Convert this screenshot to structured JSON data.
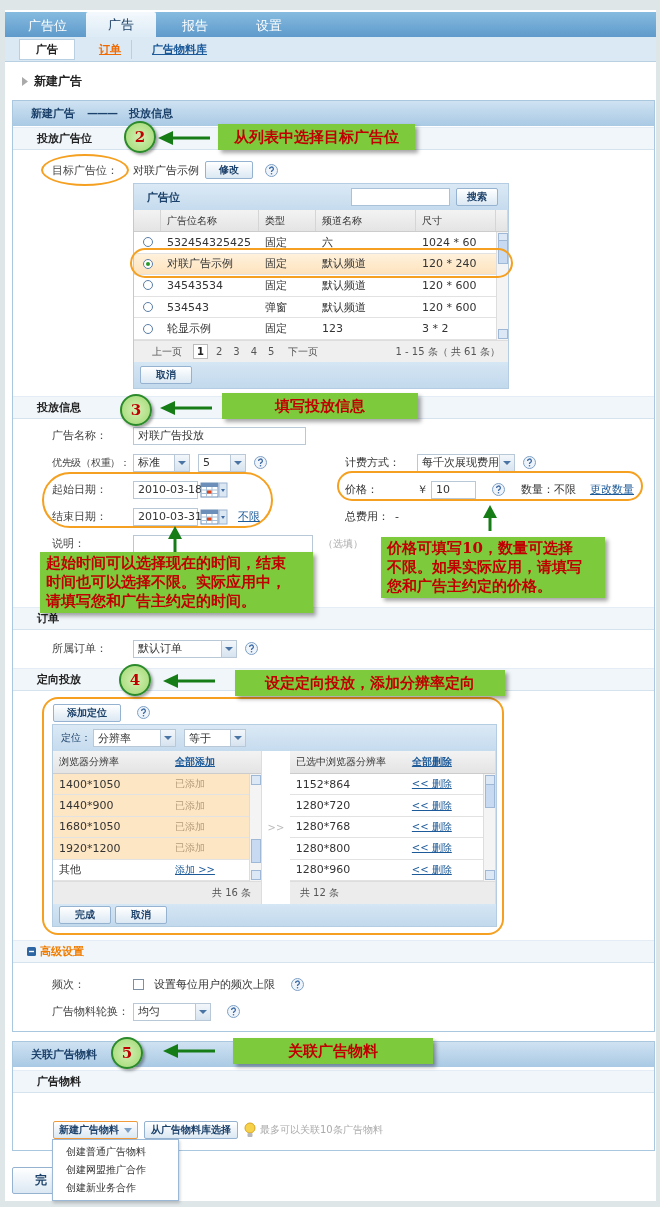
{
  "nav": {
    "tabs": [
      {
        "label": "广告位",
        "selected": false
      },
      {
        "label": "广告",
        "selected": true
      },
      {
        "label": "报告",
        "selected": false
      },
      {
        "label": "设置",
        "selected": false
      }
    ],
    "subtabs": [
      {
        "label": "广告",
        "selected": true,
        "kind": "plain"
      },
      {
        "label": "订单",
        "selected": false,
        "kind": "accent-link"
      },
      {
        "label": "广告物料库",
        "selected": false,
        "kind": "link"
      }
    ]
  },
  "title": "新建广告",
  "panel_header": {
    "step": "新建广告",
    "separator": "———",
    "current": "投放信息"
  },
  "placement": {
    "heading": "投放广告位",
    "label": "目标广告位：",
    "value": "对联广告示例",
    "edit_button": "修改",
    "table": {
      "title": "广告位",
      "search_button": "搜索",
      "columns": [
        "广告位名称",
        "类型",
        "频道名称",
        "尺寸"
      ],
      "rows": [
        {
          "selected": false,
          "cells": [
            "532454325425",
            "固定",
            "六",
            "1024 * 60"
          ]
        },
        {
          "selected": true,
          "cells": [
            "对联广告示例",
            "固定",
            "默认频道",
            "120 * 240"
          ]
        },
        {
          "selected": false,
          "cells": [
            "34543534",
            "固定",
            "默认频道",
            "120 * 600"
          ]
        },
        {
          "selected": false,
          "cells": [
            "534543",
            "弹窗",
            "默认频道",
            "120 * 600"
          ]
        },
        {
          "selected": false,
          "cells": [
            "轮显示例",
            "固定",
            "123",
            "3 * 2"
          ]
        }
      ],
      "pager": {
        "prev": "上一页",
        "pages": [
          {
            "label": "1",
            "selected": true
          },
          {
            "label": "2",
            "selected": false
          },
          {
            "label": "3",
            "selected": false
          },
          {
            "label": "4",
            "selected": false
          },
          {
            "label": "5",
            "selected": false
          }
        ],
        "next": "下一页",
        "summary": "1 - 15 条（ 共 61 条）"
      },
      "cancel_button": "取消"
    }
  },
  "delivery": {
    "heading": "投放信息",
    "name_label": "广告名称：",
    "name_value": "对联广告投放",
    "priority_label": "优先级（权重）：",
    "priority_value": "标准",
    "weight_value": "5",
    "start_label": "起始日期：",
    "start_value": "2010-03-18",
    "end_label": "结束日期：",
    "end_value": "2010-03-31",
    "unlimited_link": "不限",
    "note_label": "说明：",
    "note_hint": "（选填）",
    "billing_label": "计费方式：",
    "billing_value": "每千次展现费用",
    "price_label": "价格：",
    "currency": "￥",
    "price_value": "10",
    "quantity_label": "数量：",
    "quantity_value": "不限",
    "change_quantity_link": "更改数量",
    "total_label": "总费用：",
    "total_value": "-"
  },
  "order": {
    "heading": "订单",
    "label": "所属订单：",
    "value": "默认订单"
  },
  "targeting": {
    "heading": "定向投放",
    "add_button": "添加定位",
    "filter_label": "定位：",
    "dimension": "分辨率",
    "operator": "等于",
    "available": {
      "columns": [
        "浏览器分辨率",
        "全部添加"
      ],
      "rows": [
        {
          "value": "1400*1050",
          "action": "已添加",
          "added": true
        },
        {
          "value": "1440*900",
          "action": "已添加",
          "added": true
        },
        {
          "value": "1680*1050",
          "action": "已添加",
          "added": true
        },
        {
          "value": "1920*1200",
          "action": "已添加",
          "added": true
        },
        {
          "value": "其他",
          "action": "添加 >>",
          "added": false
        }
      ],
      "footer": "共 16 条"
    },
    "move_icon": ">>",
    "chosen": {
      "columns": [
        "已选中浏览器分辨率",
        "全部删除"
      ],
      "rows": [
        {
          "value": "1152*864",
          "action": "<< 删除"
        },
        {
          "value": "1280*720",
          "action": "<< 删除"
        },
        {
          "value": "1280*768",
          "action": "<< 删除"
        },
        {
          "value": "1280*800",
          "action": "<< 删除"
        },
        {
          "value": "1280*960",
          "action": "<< 删除"
        }
      ],
      "footer": "共 12 条"
    },
    "done_button": "完成",
    "cancel_button": "取消"
  },
  "advanced": {
    "heading": "高级设置",
    "expanded": true,
    "frequency_label": "频次：",
    "frequency_option": "设置每位用户的频次上限",
    "frequency_checked": false,
    "rotation_label": "广告物料轮换：",
    "rotation_value": "均匀"
  },
  "creatives": {
    "heading": "关联广告物料",
    "subheading": "广告物料",
    "new_button": "新建广告物料",
    "library_button": "从广告物料库选择",
    "tip": "最多可以关联10条广告物料",
    "menu": [
      "创建普通广告物料",
      "创建网盟推广合作",
      "创建新业务合作"
    ]
  },
  "finish_button": "完",
  "annotations": [
    {
      "number": "2",
      "text": "从列表中选择目标广告位"
    },
    {
      "number": "3",
      "text": "填写投放信息"
    },
    {
      "number": "4",
      "text": "设定定向投放，添加分辨率定向"
    },
    {
      "number": "5",
      "text": "关联广告物料"
    }
  ],
  "notes": [
    {
      "text": "起始时间可以选择现在的时间，结束时间也可以选择不限。实际应用中，请填写您和广告主约定的时间。"
    },
    {
      "text": "价格可填写10，数量可选择不限。如果实际应用，请填写您和广告主约定的价格。"
    }
  ]
}
